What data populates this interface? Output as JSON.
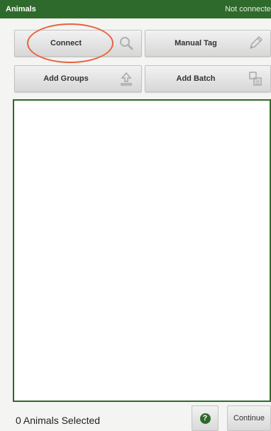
{
  "titlebar": {
    "title": "Animals",
    "status": "Not connected"
  },
  "toolbar": {
    "connect": {
      "label": "Connect",
      "icon": "search-icon"
    },
    "manual_tag": {
      "label": "Manual Tag",
      "icon": "pencil-icon"
    },
    "add_groups": {
      "label": "Add Groups",
      "icon": "upload-icon"
    },
    "add_batch": {
      "label": "Add Batch",
      "icon": "batch-icon"
    }
  },
  "footer": {
    "selected_label": "0 Animals Selected",
    "help_glyph": "?",
    "continue_label": "Continue"
  },
  "colors": {
    "header": "#2e6a2b",
    "list_border": "#2e6a2b",
    "highlight_ellipse": "#e8623a"
  }
}
